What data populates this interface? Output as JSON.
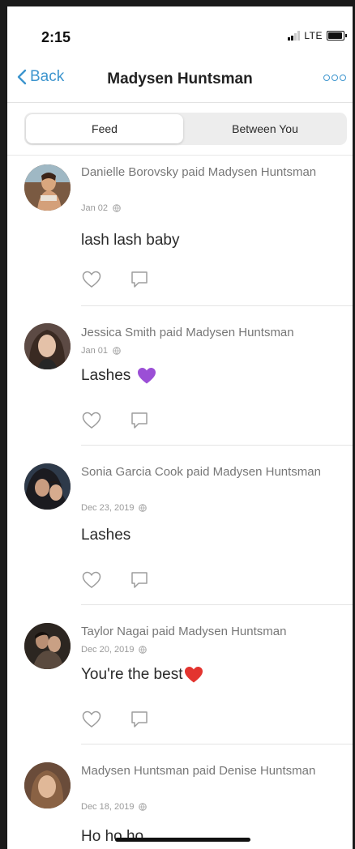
{
  "status_bar": {
    "time": "2:15",
    "network": "LTE"
  },
  "nav": {
    "back_label": "Back",
    "title": "Madysen Huntsman",
    "accent_color": "#3d95ce"
  },
  "tabs": {
    "feed_label": "Feed",
    "between_label": "Between You",
    "selected": "Feed"
  },
  "feed": [
    {
      "payment": "Danielle Borovsky paid Madysen Huntsman",
      "date": "Jan 02",
      "note": "lash lash baby",
      "emoji": ""
    },
    {
      "payment": "Jessica Smith paid Madysen Huntsman",
      "date": "Jan 01",
      "note": "Lashes",
      "emoji": "purple-heart"
    },
    {
      "payment": "Sonia Garcia Cook paid Madysen Huntsman",
      "date": "Dec 23, 2019",
      "note": "Lashes",
      "emoji": ""
    },
    {
      "payment": "Taylor Nagai paid Madysen Huntsman",
      "date": "Dec 20, 2019",
      "note": "You're the best",
      "emoji": "red-heart"
    },
    {
      "payment": "Madysen Huntsman paid Denise Huntsman",
      "date": "Dec 18, 2019",
      "note": "Ho ho ho",
      "emoji": ""
    }
  ]
}
